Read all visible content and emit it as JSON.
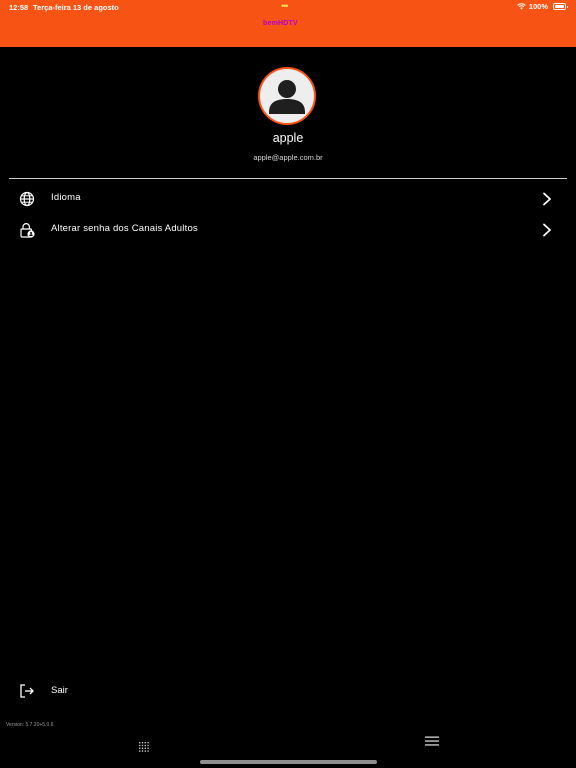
{
  "status_bar": {
    "time": "12:58",
    "date": "Terça-feira 13 de agosto",
    "dots": "•••",
    "battery": "100%"
  },
  "header": {
    "logo_text": "bemHDTV",
    "background_color": "#F65314"
  },
  "profile": {
    "name": "apple",
    "email": "apple@apple.com.br",
    "avatar_icon": "person-icon"
  },
  "menu": {
    "items": [
      {
        "label": "Idioma",
        "icon": "globe-icon"
      },
      {
        "label": "Alterar senha dos Canais Adultos",
        "icon": "lock-person-icon"
      }
    ],
    "logout_label": "Sair"
  },
  "footer": {
    "version": "Version: 5.7.20+5.0.6"
  },
  "colors": {
    "accent": "#F65314",
    "background": "#000000",
    "text": "#FFFFFF"
  }
}
